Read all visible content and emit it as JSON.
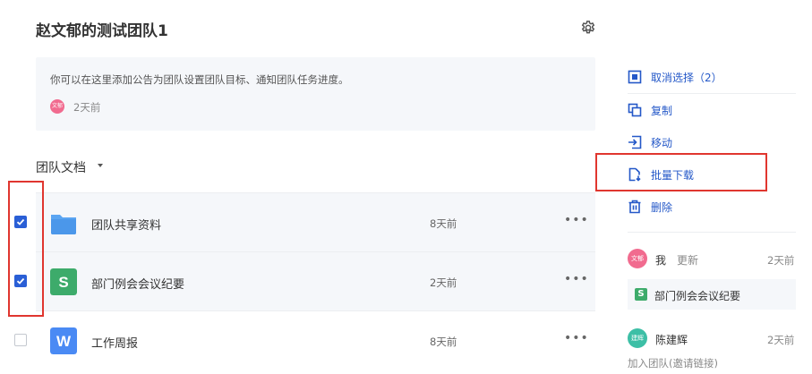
{
  "team": {
    "title": "赵文郁的测试团队1"
  },
  "notice": {
    "text": "你可以在这里添加公告为团队设置团队目标、通知团队任务进度。",
    "avatar_label": "文郁",
    "time": "2天前"
  },
  "docs": {
    "section_title": "团队文档",
    "files": [
      {
        "name": "团队共享资料",
        "time": "8天前",
        "type": "folder",
        "checked": true
      },
      {
        "name": "部门例会会议纪要",
        "time": "2天前",
        "type": "sheet",
        "checked": true
      },
      {
        "name": "工作周报",
        "time": "8天前",
        "type": "word",
        "checked": false
      }
    ],
    "more_label": "•••"
  },
  "actions": {
    "deselect": "取消选择（2）",
    "copy": "复制",
    "move": "移动",
    "batch_download": "批量下载",
    "delete": "删除"
  },
  "activity": [
    {
      "avatar_label": "文郁",
      "user": "我",
      "verb": "更新",
      "time": "2天前",
      "file": "部门例会会议纪要",
      "file_icon": "S",
      "avatar_color": "#f16b8f"
    },
    {
      "avatar_label": "建辉",
      "user": "陈建辉",
      "time": "2天前",
      "subtext": "加入团队(邀请链接)",
      "avatar_color": "#3dbfa6"
    }
  ],
  "colors": {
    "accent": "#2458c8",
    "checkbox": "#2a5fd6",
    "highlight_box": "#e0362f",
    "folder": "#5aa5f2",
    "sheet": "#3dab6b",
    "word": "#4a8af4"
  }
}
